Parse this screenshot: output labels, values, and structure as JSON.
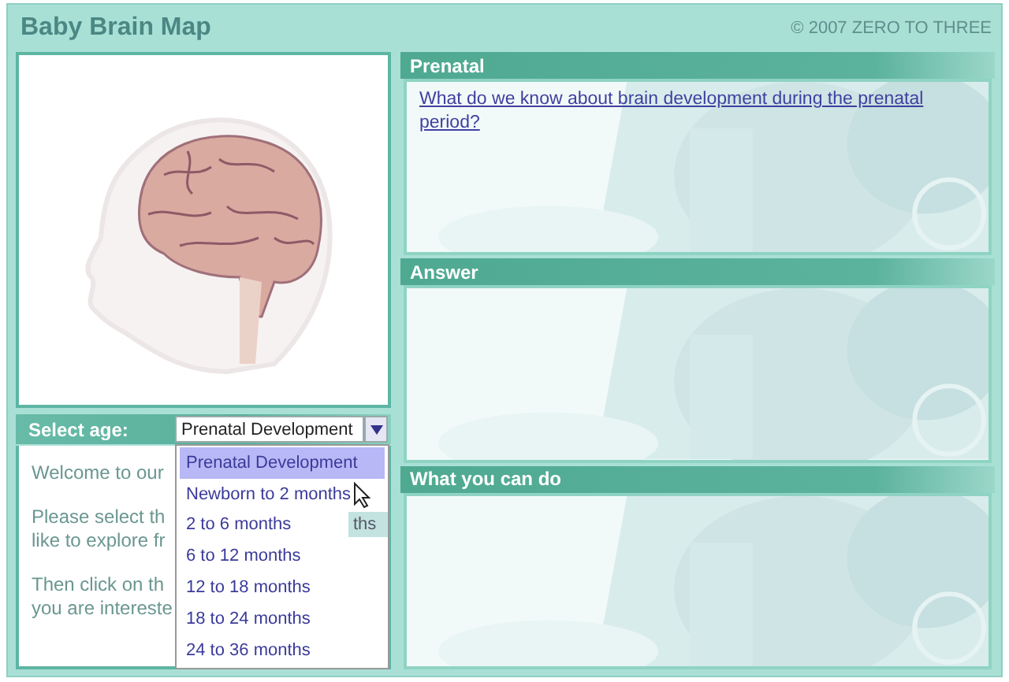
{
  "window": {
    "title": "Baby Brain Map",
    "copyright": "© 2007 ZERO TO THREE"
  },
  "age_selector": {
    "label": "Select age:",
    "value": "Prenatal Development",
    "expanded": true,
    "options": [
      {
        "label": "Prenatal Development",
        "selected": true
      },
      {
        "label": "Newborn to 2 months",
        "selected": false
      },
      {
        "label": "2 to 6 months",
        "selected": false
      },
      {
        "label": "6 to 12 months",
        "selected": false
      },
      {
        "label": "12 to 18 months",
        "selected": false
      },
      {
        "label": "18 to 24 months",
        "selected": false
      },
      {
        "label": "24 to 36 months",
        "selected": false
      }
    ]
  },
  "tooltip_fragment": "ths",
  "intro": {
    "paragraphs": [
      [
        "Welcome to our"
      ],
      [
        "Please select th",
        "like to explore fr"
      ],
      [
        "Then click on th",
        "you are intereste"
      ]
    ]
  },
  "panels": [
    {
      "title": "Prenatal",
      "link": "What do we know about brain development during the prenatal period?"
    },
    {
      "title": "Answer"
    },
    {
      "title": "What you can do"
    }
  ]
}
